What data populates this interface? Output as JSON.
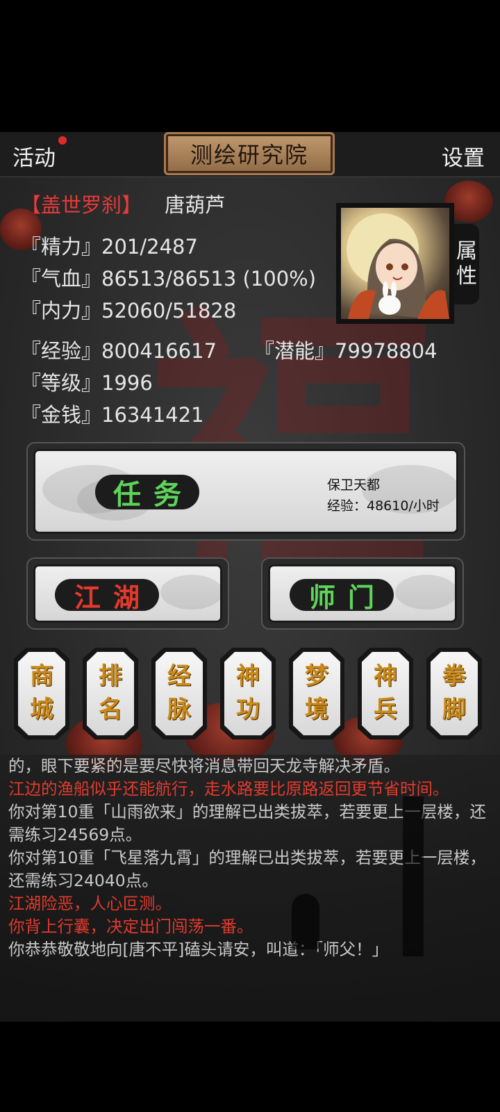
{
  "header": {
    "activities_label": "活动",
    "title": "测绘研究院",
    "settings_label": "设置"
  },
  "character": {
    "rank": "【盖世罗刹】",
    "name": "唐葫芦",
    "stats": [
      {
        "label": "『精力』",
        "value": "201/2487"
      },
      {
        "label": "『气血』",
        "value": "86513/86513 (100%)"
      },
      {
        "label": "『内力』",
        "value": "52060/51828"
      },
      {
        "label": "『经验』",
        "value": "800416617"
      },
      {
        "label": "『潜能』",
        "value": "79978804"
      },
      {
        "label": "『等级』",
        "value": "1996"
      },
      {
        "label": "『金钱』",
        "value": "16341421"
      }
    ],
    "attr_tab": [
      "属",
      "性"
    ]
  },
  "quest": {
    "button_label": "任务",
    "name": "保卫天都",
    "exp_rate": "经验：48610/小时"
  },
  "buttons": {
    "jianghu": "江湖",
    "shimen": "师门"
  },
  "menu": [
    [
      "商",
      "城"
    ],
    [
      "排",
      "名"
    ],
    [
      "经",
      "脉"
    ],
    [
      "神",
      "功"
    ],
    [
      "梦",
      "境"
    ],
    [
      "神",
      "兵"
    ],
    [
      "拳",
      "脚"
    ]
  ],
  "log": [
    {
      "text": "的，眼下要紧的是要尽快将消息带回天龙寺解决矛盾。",
      "color": "gray"
    },
    {
      "text": "江边的渔船似乎还能航行，走水路要比原路返回更节省时间。",
      "color": "red"
    },
    {
      "text": "你对第10重「山雨欲来」的理解已出类拔萃，若要更上一层楼，还需练习24569点。",
      "color": "gray"
    },
    {
      "text": "你对第10重「飞星落九霄」的理解已出类拔萃，若要更上一层楼，还需练习24040点。",
      "color": "gray"
    },
    {
      "text": "江湖险恶，人心叵测。",
      "color": "red"
    },
    {
      "text": "你背上行囊，决定出门闯荡一番。",
      "color": "red"
    },
    {
      "text": "你恭恭敬敬地向[唐不平]磕头请安，叫道：「师父！」",
      "color": "gray"
    }
  ],
  "colors": {
    "accent_red": "#e33a2c",
    "accent_green": "#5dd45a",
    "gold": "#c98a1a"
  }
}
